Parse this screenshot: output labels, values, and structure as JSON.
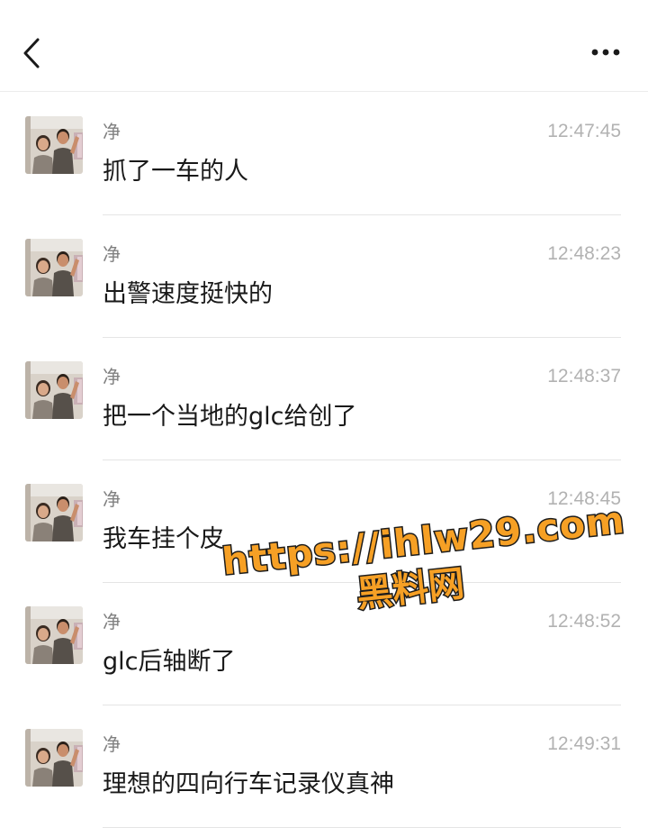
{
  "colors": {
    "timestamp": "#b2b2b2",
    "sender": "#808080",
    "message": "#191919",
    "divider": "#e5e5e5",
    "watermark_fill": "#f6a025",
    "watermark_outline": "#1c1c1c"
  },
  "header": {
    "back_icon": "chevron-left-icon",
    "more_icon": "more-horizontal-icon"
  },
  "messages": [
    {
      "sender": "净",
      "time": "12:47:45",
      "text": "抓了一车的人"
    },
    {
      "sender": "净",
      "time": "12:48:23",
      "text": "出警速度挺快的"
    },
    {
      "sender": "净",
      "time": "12:48:37",
      "text": "把一个当地的glc给创了"
    },
    {
      "sender": "净",
      "time": "12:48:45",
      "text": "我车挂个皮"
    },
    {
      "sender": "净",
      "time": "12:48:52",
      "text": "glc后轴断了"
    },
    {
      "sender": "净",
      "time": "12:49:31",
      "text": "理想的四向行车记录仪真神"
    }
  ],
  "watermark": {
    "url": "https://ihlw29.com",
    "label": "黑料网"
  }
}
